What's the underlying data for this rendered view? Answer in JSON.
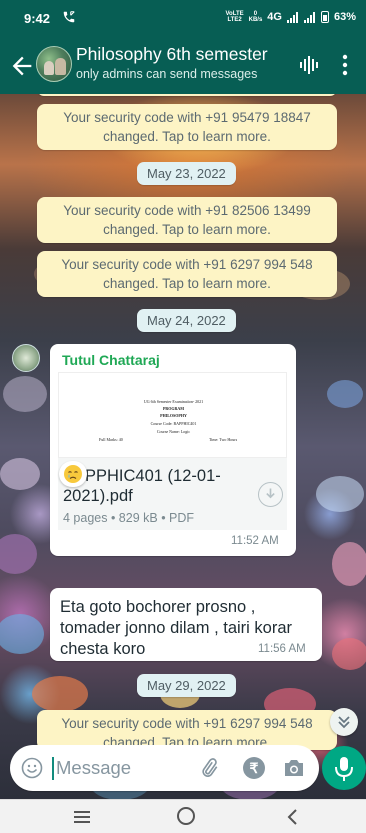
{
  "status_bar": {
    "time": "9:42",
    "carrier_top": "VoLTE",
    "carrier_bottom": "LTE2",
    "speed_top": "0",
    "speed_bottom": "KB/s",
    "network": "4G",
    "battery": "63%"
  },
  "header": {
    "title": "Philosophy 6th semester",
    "subtitle": "only admins can send messages"
  },
  "chat": {
    "messages": [
      {
        "type": "system",
        "text": "Your security code with +91 95479 18847 changed. Tap to learn more."
      },
      {
        "type": "date",
        "text": "May 23, 2022"
      },
      {
        "type": "system",
        "text": "Your security code with +91 82506 13499 changed. Tap to learn more."
      },
      {
        "type": "system",
        "text": "Your security code with +91 6297 994 548 changed. Tap to learn more."
      },
      {
        "type": "date",
        "text": "May 24, 2022"
      },
      {
        "type": "document",
        "sender": "Tutul Chattaraj",
        "preview_lines": [
          "UG 6th Semester Examination- 2021",
          "PROGRAM",
          "PHILOSOPHY",
          "Course Code: BAPPHIC401",
          "Course Name: Logic"
        ],
        "preview_marks": "Full Marks: 40",
        "preview_time": "Time: Two Hours",
        "file_name": "BAPPHIC401 (12-01-2021).pdf",
        "meta": "4 pages • 829 kB • PDF",
        "time": "11:52 AM"
      },
      {
        "type": "reaction",
        "emoji": "😢"
      },
      {
        "type": "text",
        "text": "Eta goto bochorer prosno , tomader jonno dilam , tairi korar chesta koro",
        "time": "11:56 AM"
      },
      {
        "type": "date",
        "text": "May 29, 2022"
      },
      {
        "type": "system",
        "text": "Your security code with +91 6297 994 548 changed. Tap to learn more."
      }
    ]
  },
  "composer": {
    "placeholder": "Message",
    "rupee_symbol": "₹"
  },
  "colors": {
    "header_green": "#075e54",
    "sender_green": "#1fa855",
    "mic_green": "#00a884",
    "system_bg": "#fdf4c5",
    "date_chip_bg": "#e1f1f3"
  },
  "icons": [
    "phone-call-icon",
    "battery-icon",
    "back-arrow-icon",
    "group-avatar",
    "voice-call-icon",
    "more-options-icon",
    "download-icon",
    "crying-emoji",
    "scroll-down-icon",
    "emoji-icon",
    "attach-icon",
    "rupee-icon",
    "camera-icon",
    "mic-icon",
    "recents-icon",
    "home-icon",
    "nav-back-icon"
  ]
}
